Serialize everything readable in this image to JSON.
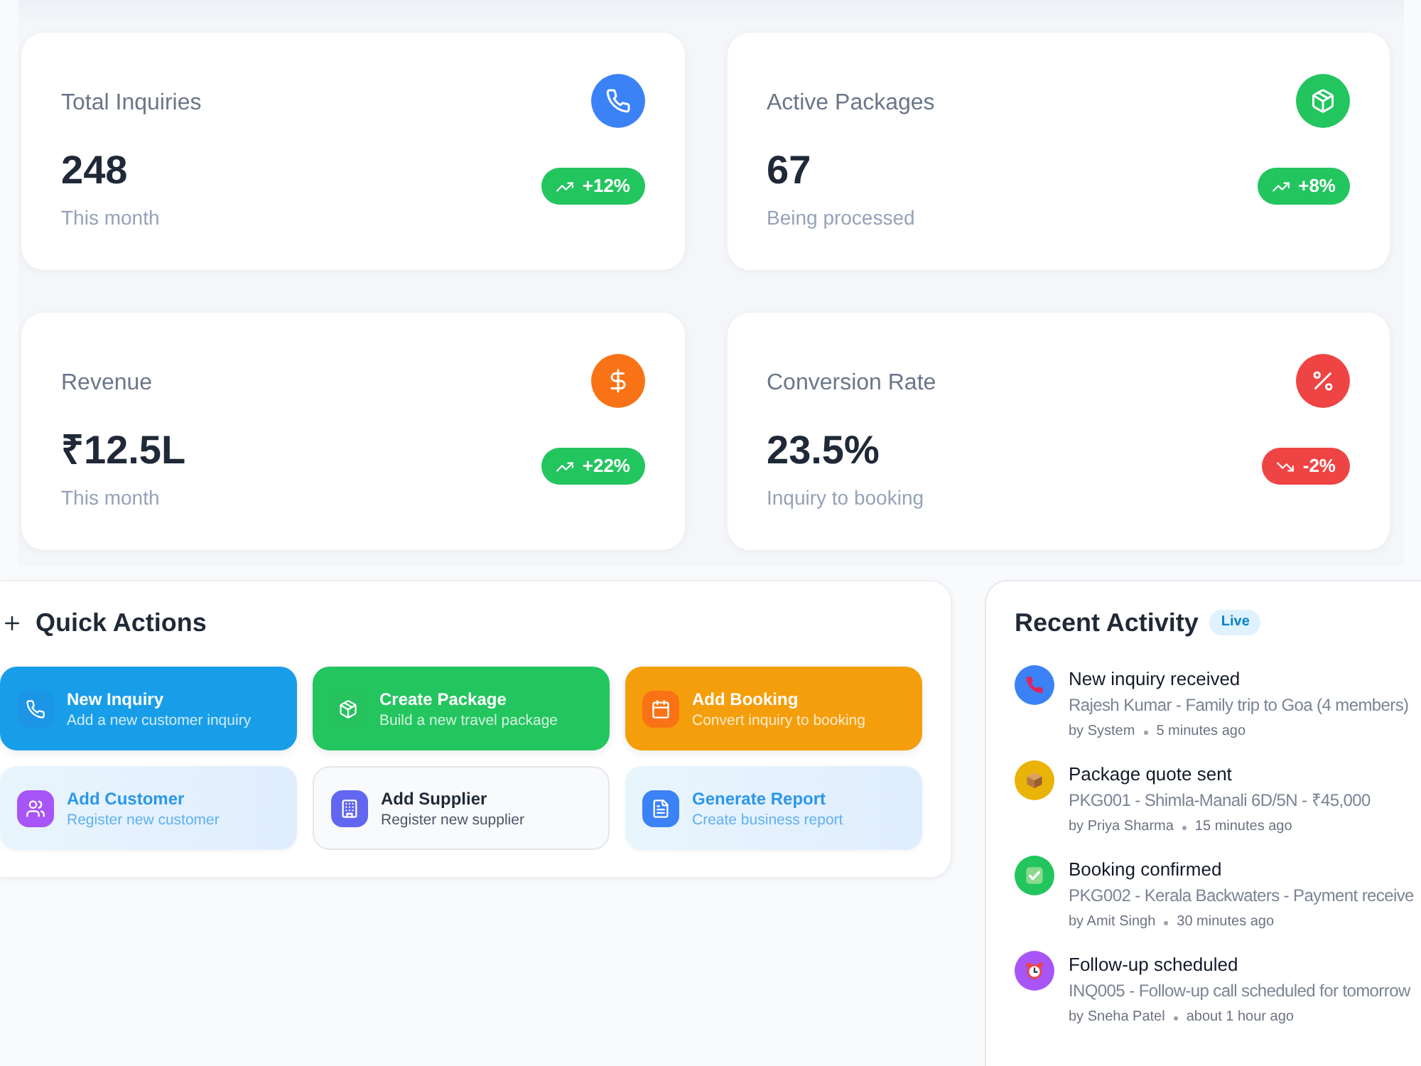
{
  "stats": [
    {
      "kind": "phone",
      "color": "#3b82f6",
      "label": "Total Inquiries",
      "value": "248",
      "caption": "This month",
      "up": true,
      "change": "+12%"
    },
    {
      "kind": "package",
      "color": "#22c55e",
      "label": "Active Packages",
      "value": "67",
      "caption": "Being processed",
      "up": true,
      "change": "+8%"
    },
    {
      "kind": "dollar",
      "color": "#f97316",
      "label": "Revenue",
      "value": "₹12.5L",
      "caption": "This month",
      "up": true,
      "change": "+22%"
    },
    {
      "kind": "percent",
      "color": "#ef4444",
      "label": "Conversion Rate",
      "value": "23.5%",
      "caption": "Inquiry to booking",
      "up": false,
      "change": "-2%"
    }
  ],
  "quick_actions": {
    "title": "Quick Actions",
    "actions": [
      {
        "kind": "inquiry",
        "color": "#1c95e6",
        "label": "New Inquiry",
        "description": "Add a new customer inquiry"
      },
      {
        "kind": "package",
        "color": "#25c25e",
        "label": "Create Package",
        "description": "Build a new travel package"
      },
      {
        "kind": "booking",
        "color": "#f97316",
        "label": "Add Booking",
        "description": "Convert inquiry to booking"
      },
      {
        "kind": "customer",
        "color": "#a855f7",
        "label": "Add Customer",
        "description": "Register new customer"
      },
      {
        "kind": "supplier",
        "color": "#6366f1",
        "label": "Add Supplier",
        "description": "Register new supplier"
      },
      {
        "kind": "report",
        "color": "#3b82f6",
        "label": "Generate Report",
        "description": "Create business report"
      }
    ]
  },
  "recent_activity": {
    "title": "Recent Activity",
    "badge": "Live",
    "items": [
      {
        "kind": "inquiry",
        "color": "#3b82f6",
        "title": "New inquiry received",
        "description": "Rajesh Kumar - Family trip to Goa (4 members)",
        "author": "by System",
        "time": "5 minutes ago"
      },
      {
        "kind": "quote",
        "color": "#eab308",
        "title": "Package quote sent",
        "description": "PKG001 - Shimla-Manali 6D/5N - ₹45,000",
        "author": "by Priya Sharma",
        "time": "15 minutes ago"
      },
      {
        "kind": "booking",
        "color": "#22c55e",
        "title": "Booking confirmed",
        "description": "PKG002 - Kerala Backwaters - Payment receive",
        "author": "by Amit Singh",
        "time": "30 minutes ago"
      },
      {
        "kind": "follow_up",
        "color": "#a855f7",
        "title": "Follow-up scheduled",
        "description": "INQ005 - Follow-up call scheduled for tomorrow",
        "author": "by Sneha Patel",
        "time": "about 1 hour ago"
      }
    ]
  }
}
